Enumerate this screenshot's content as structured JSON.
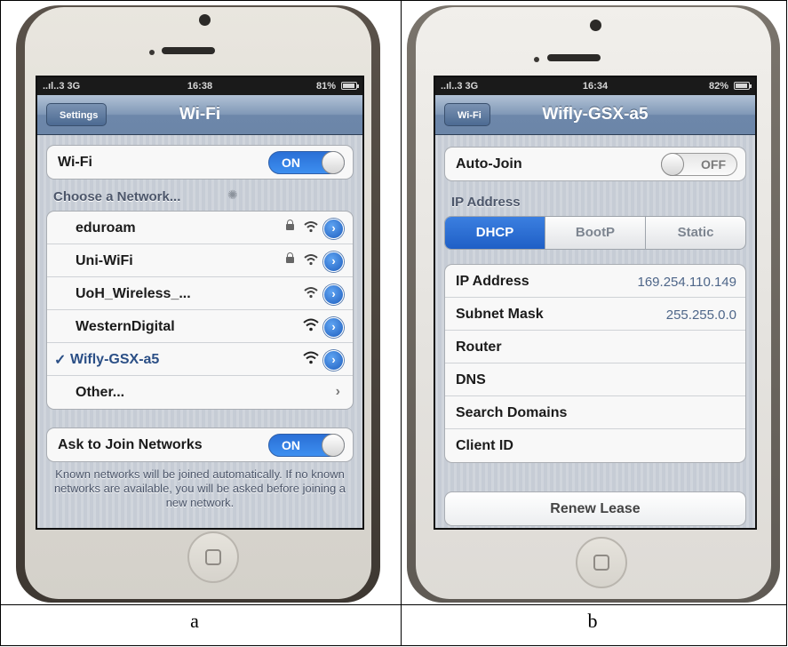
{
  "captions": {
    "left": "a",
    "right": "b"
  },
  "panel_a": {
    "status": {
      "carrier": "..ıl..3 3G",
      "time": "16:38",
      "battery": "81%"
    },
    "nav": {
      "back_label": "Settings",
      "title": "Wi-Fi"
    },
    "wifi_row": {
      "label": "Wi-Fi",
      "toggle": "ON"
    },
    "choose_header": "Choose a Network...",
    "networks": [
      {
        "name": "eduroam",
        "locked": true
      },
      {
        "name": "Uni-WiFi",
        "locked": true
      },
      {
        "name": "UoH_Wireless_...",
        "locked": false
      },
      {
        "name": "WesternDigital",
        "locked": false
      },
      {
        "name": "Wifly-GSX-a5",
        "locked": false,
        "selected": true
      }
    ],
    "other_label": "Other...",
    "ask_row": {
      "label": "Ask to Join Networks",
      "toggle": "ON"
    },
    "footer_note": "Known networks will be joined automatically. If no known networks are available, you will be asked before joining a new network."
  },
  "panel_b": {
    "status": {
      "carrier": "..ıl..3 3G",
      "time": "16:34",
      "battery": "82%"
    },
    "nav": {
      "back_label": "Wi-Fi",
      "title": "Wifly-GSX-a5"
    },
    "auto_join": {
      "label": "Auto-Join",
      "toggle": "OFF"
    },
    "ip_header": "IP Address",
    "segments": [
      "DHCP",
      "BootP",
      "Static"
    ],
    "active_segment": "DHCP",
    "details": [
      {
        "label": "IP Address",
        "value": "169.254.110.149"
      },
      {
        "label": "Subnet Mask",
        "value": "255.255.0.0"
      },
      {
        "label": "Router",
        "value": ""
      },
      {
        "label": "DNS",
        "value": ""
      },
      {
        "label": "Search Domains",
        "value": ""
      },
      {
        "label": "Client ID",
        "value": ""
      }
    ],
    "renew_label": "Renew Lease"
  },
  "colors": {
    "accent_blue": "#2a6fd6",
    "nav_bar": "#6d87aa",
    "text_value": "#4e6689"
  }
}
